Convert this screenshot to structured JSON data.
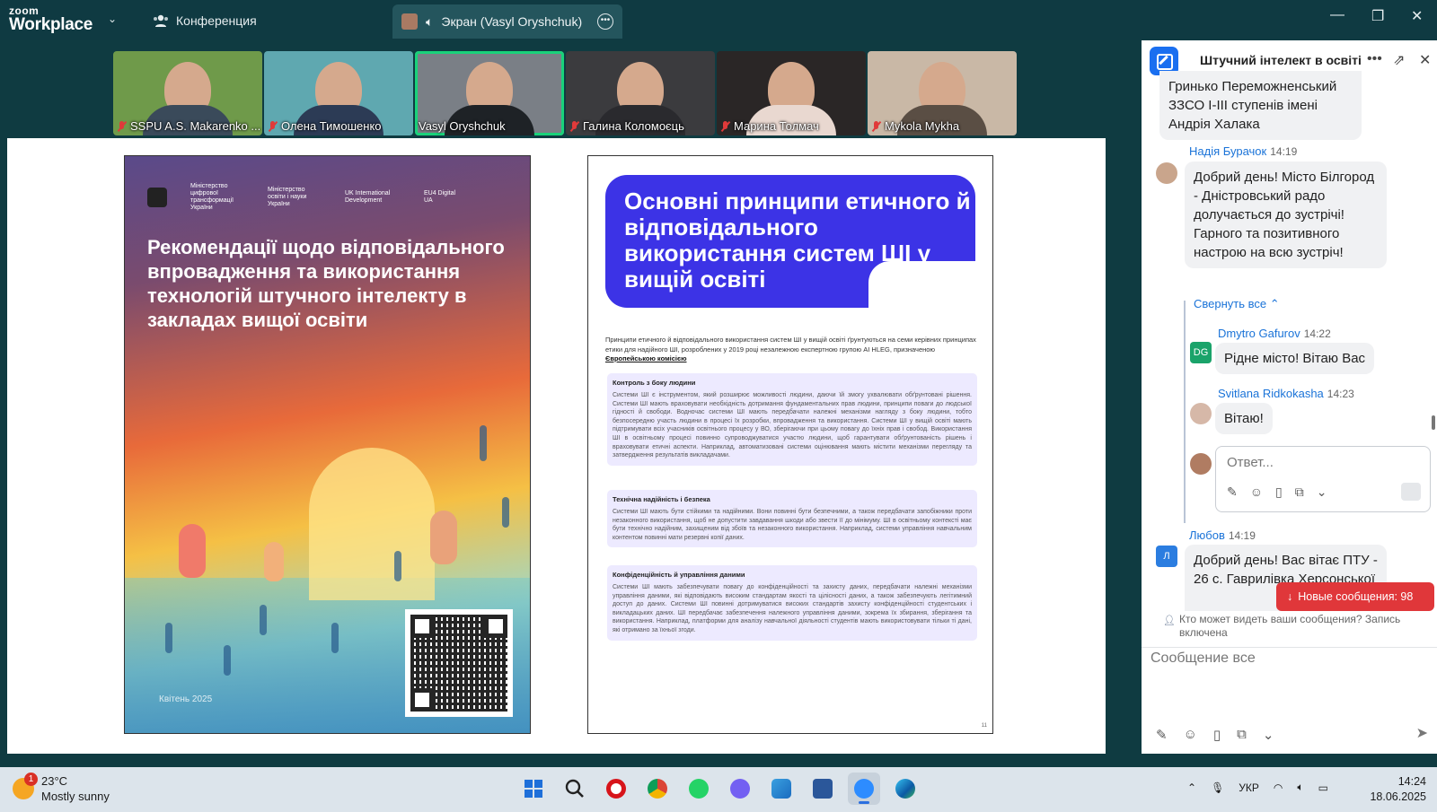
{
  "titlebar": {
    "logo_top": "zoom",
    "logo_bottom": "Workplace",
    "conference_label": "Конференция",
    "screen_tab_label": "Экран (Vasyl Oryshchuk)"
  },
  "participants": [
    {
      "name": "SSPU A.S. Makarenko ...",
      "muted": true,
      "bg": "#6f9a4a",
      "shirt": "#3a4a5a"
    },
    {
      "name": "Олена Тимошенко",
      "muted": true,
      "bg": "#5fa8b0",
      "shirt": "#2c3b55"
    },
    {
      "name": "Vasyl Oryshchuk",
      "muted": false,
      "bg": "#7a7f86",
      "shirt": "#1e2226"
    },
    {
      "name": "Галина Коломоєць",
      "muted": true,
      "bg": "#3b3b3e",
      "shirt": "#2a2a2e"
    },
    {
      "name": "Марина Толмач",
      "muted": true,
      "bg": "#2a2626",
      "shirt": "#e9d8d0"
    },
    {
      "name": "Mykola Mykha",
      "muted": true,
      "bg": "#c9b8a6",
      "shirt": "#5a4e44"
    }
  ],
  "shared_doc": {
    "left_page": {
      "title": "Рекомендації щодо відповідального впровадження та використання технологій штучного інтелекту в закладах вищої освіти",
      "date": "Квітень 2025",
      "logo_labels": [
        "Міністерство цифрової трансформації України",
        "Міністерство освіти і науки України",
        "UK International Development",
        "EU4 Digital UA"
      ]
    },
    "right_page": {
      "banner_title": "Основні принципи етичного й відповідального використання систем ШІ у вищій освіті",
      "intro": "Принципи етичного й відповідального використання систем ШІ у вищій освіті ґрунтуються на семи керівних принципах етики для надійного ШІ, розроблених у 2019 році незалежною експертною групою AI HLEG, призначеною",
      "intro_link": "Європейською комісією",
      "sections": [
        {
          "title": "Контроль з боку людини",
          "text": "Системи ШІ є інструментом, який розширює можливості людини, даючи їй змогу ухвалювати обґрунтовані рішення. Системи ШІ мають враховувати необхідність дотримання фундаментальних прав людини, принципи поваги до людської гідності й свободи. Водночас системи ШІ мають передбачати належні механізми нагляду з боку людини, тобто безпосередню участь людини в процесі їх розробки, впровадження та використання. Системи ШІ у вищій освіті мають підтримувати всіх учасників освітнього процесу у ВО, зберігаючи при цьому повагу до їхніх прав і свобод. Використання ШІ в освітньому процесі повинно супроводжуватися участю людини, щоб гарантувати обґрунтованість рішень і враховувати етичні аспекти. Наприклад, автоматизовані системи оцінювання мають містити механізми перегляду та затвердження результатів викладачами."
        },
        {
          "title": "Технічна надійність і безпека",
          "text": "Системи ШІ мають бути стійкими та надійними. Вони повинні бути безпечними, а також передбачати запобіжники проти незаконного використання, щоб не допустити завдавання шкоди або звести її до мінімуму. ШІ в освітньому контексті має бути технічно надійним, захищеним від збоїв та незаконного використання. Наприклад, системи управління навчальним контентом повинні мати резервні копії даних."
        },
        {
          "title": "Конфіденційність й управління даними",
          "text": "Системи ШІ мають забезпечувати повагу до конфіденційності та захисту даних, передбачати належні механізми управління даними, які відповідають високим стандартам якості та цілісності даних, а також забезпечують легітимний доступ до даних. Системи ШІ повинні дотримуватися високих стандартів захисту конфіденційності студентських і викладацьких даних. ШІ передбачає забезпечення належного управління даними, зокрема їх збирання, зберігання та використання. Наприклад, платформи для аналізу навчальної діяльності студентів мають використовувати тільки ті дані, які отримано за їхньої згоди."
        }
      ],
      "page_number": "11"
    }
  },
  "chat": {
    "title": "Штучний інтелект в освіті",
    "messages": [
      {
        "text": "Гринько Переможненський ЗЗСО І-ІІІ ступенів імені Андрія Халака"
      },
      {
        "sender": "Надія Бурачок",
        "time": "14:19",
        "text": "Добрий день!  Місто Білгород  - Дністровський радо долучається до зустрічі! Гарного та позитивного настрою на всю зустріч!"
      },
      {
        "collapse_label": "Свернуть все"
      },
      {
        "sender": "Dmytro Gafurov",
        "time": "14:22",
        "avatar": "DG",
        "text": "Рідне місто! Вітаю Вас"
      },
      {
        "sender": "Svitlana Ridkokasha",
        "time": "14:23",
        "text": "Вітаю!"
      },
      {
        "sender": "Любов",
        "time": "14:19",
        "avatar": "Л",
        "text": "Добрий день! Вас вітає ПТУ - 26 с. Гаврилівка Херсонської"
      }
    ],
    "reply_placeholder": "Ответ...",
    "new_messages": "Новые сообщения: 98",
    "privacy_note": "Кто может видеть ваши сообщения? Запись включена",
    "compose_placeholder": "Сообщение все"
  },
  "taskbar": {
    "weather_temp": "23°C",
    "weather_cond": "Mostly sunny",
    "weather_badge": "1",
    "lang": "УКР",
    "time": "14:24",
    "date": "18.06.2025",
    "apps": [
      "start",
      "search",
      "opera",
      "chrome",
      "whatsapp",
      "viber",
      "photos",
      "word",
      "zoom",
      "edge"
    ]
  },
  "colors": {
    "accent": "#1a6ff0",
    "active_speaker": "#19d27a",
    "new_messages": "#e0373a",
    "banner": "#3c33e6"
  }
}
